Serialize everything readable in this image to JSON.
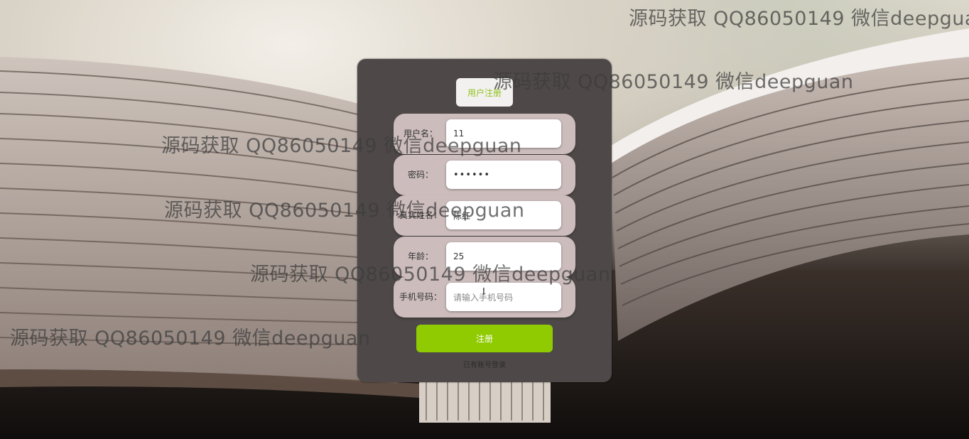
{
  "watermark_text": "源码获取 QQ86050149 微信deepguan",
  "form": {
    "title": "用户注册",
    "fields": [
      {
        "label": "用户名：",
        "value": "11",
        "placeholder": ""
      },
      {
        "label": "密码：",
        "value": "••••••",
        "placeholder": ""
      },
      {
        "label": "真实姓名：",
        "value": "陈红",
        "placeholder": ""
      },
      {
        "label": "年龄：",
        "value": "25",
        "placeholder": ""
      },
      {
        "label": "手机号码：",
        "value": "",
        "placeholder": "请输入手机号码"
      }
    ],
    "submit_label": "注册",
    "login_link": "已有账号登录"
  },
  "colors": {
    "card_bg": "#4e4948",
    "row_bg": "#ccbcbc",
    "accent_green": "#8fcb00",
    "title_text": "#8fc31f"
  },
  "icons": {
    "cursor": "text-cursor-icon"
  }
}
